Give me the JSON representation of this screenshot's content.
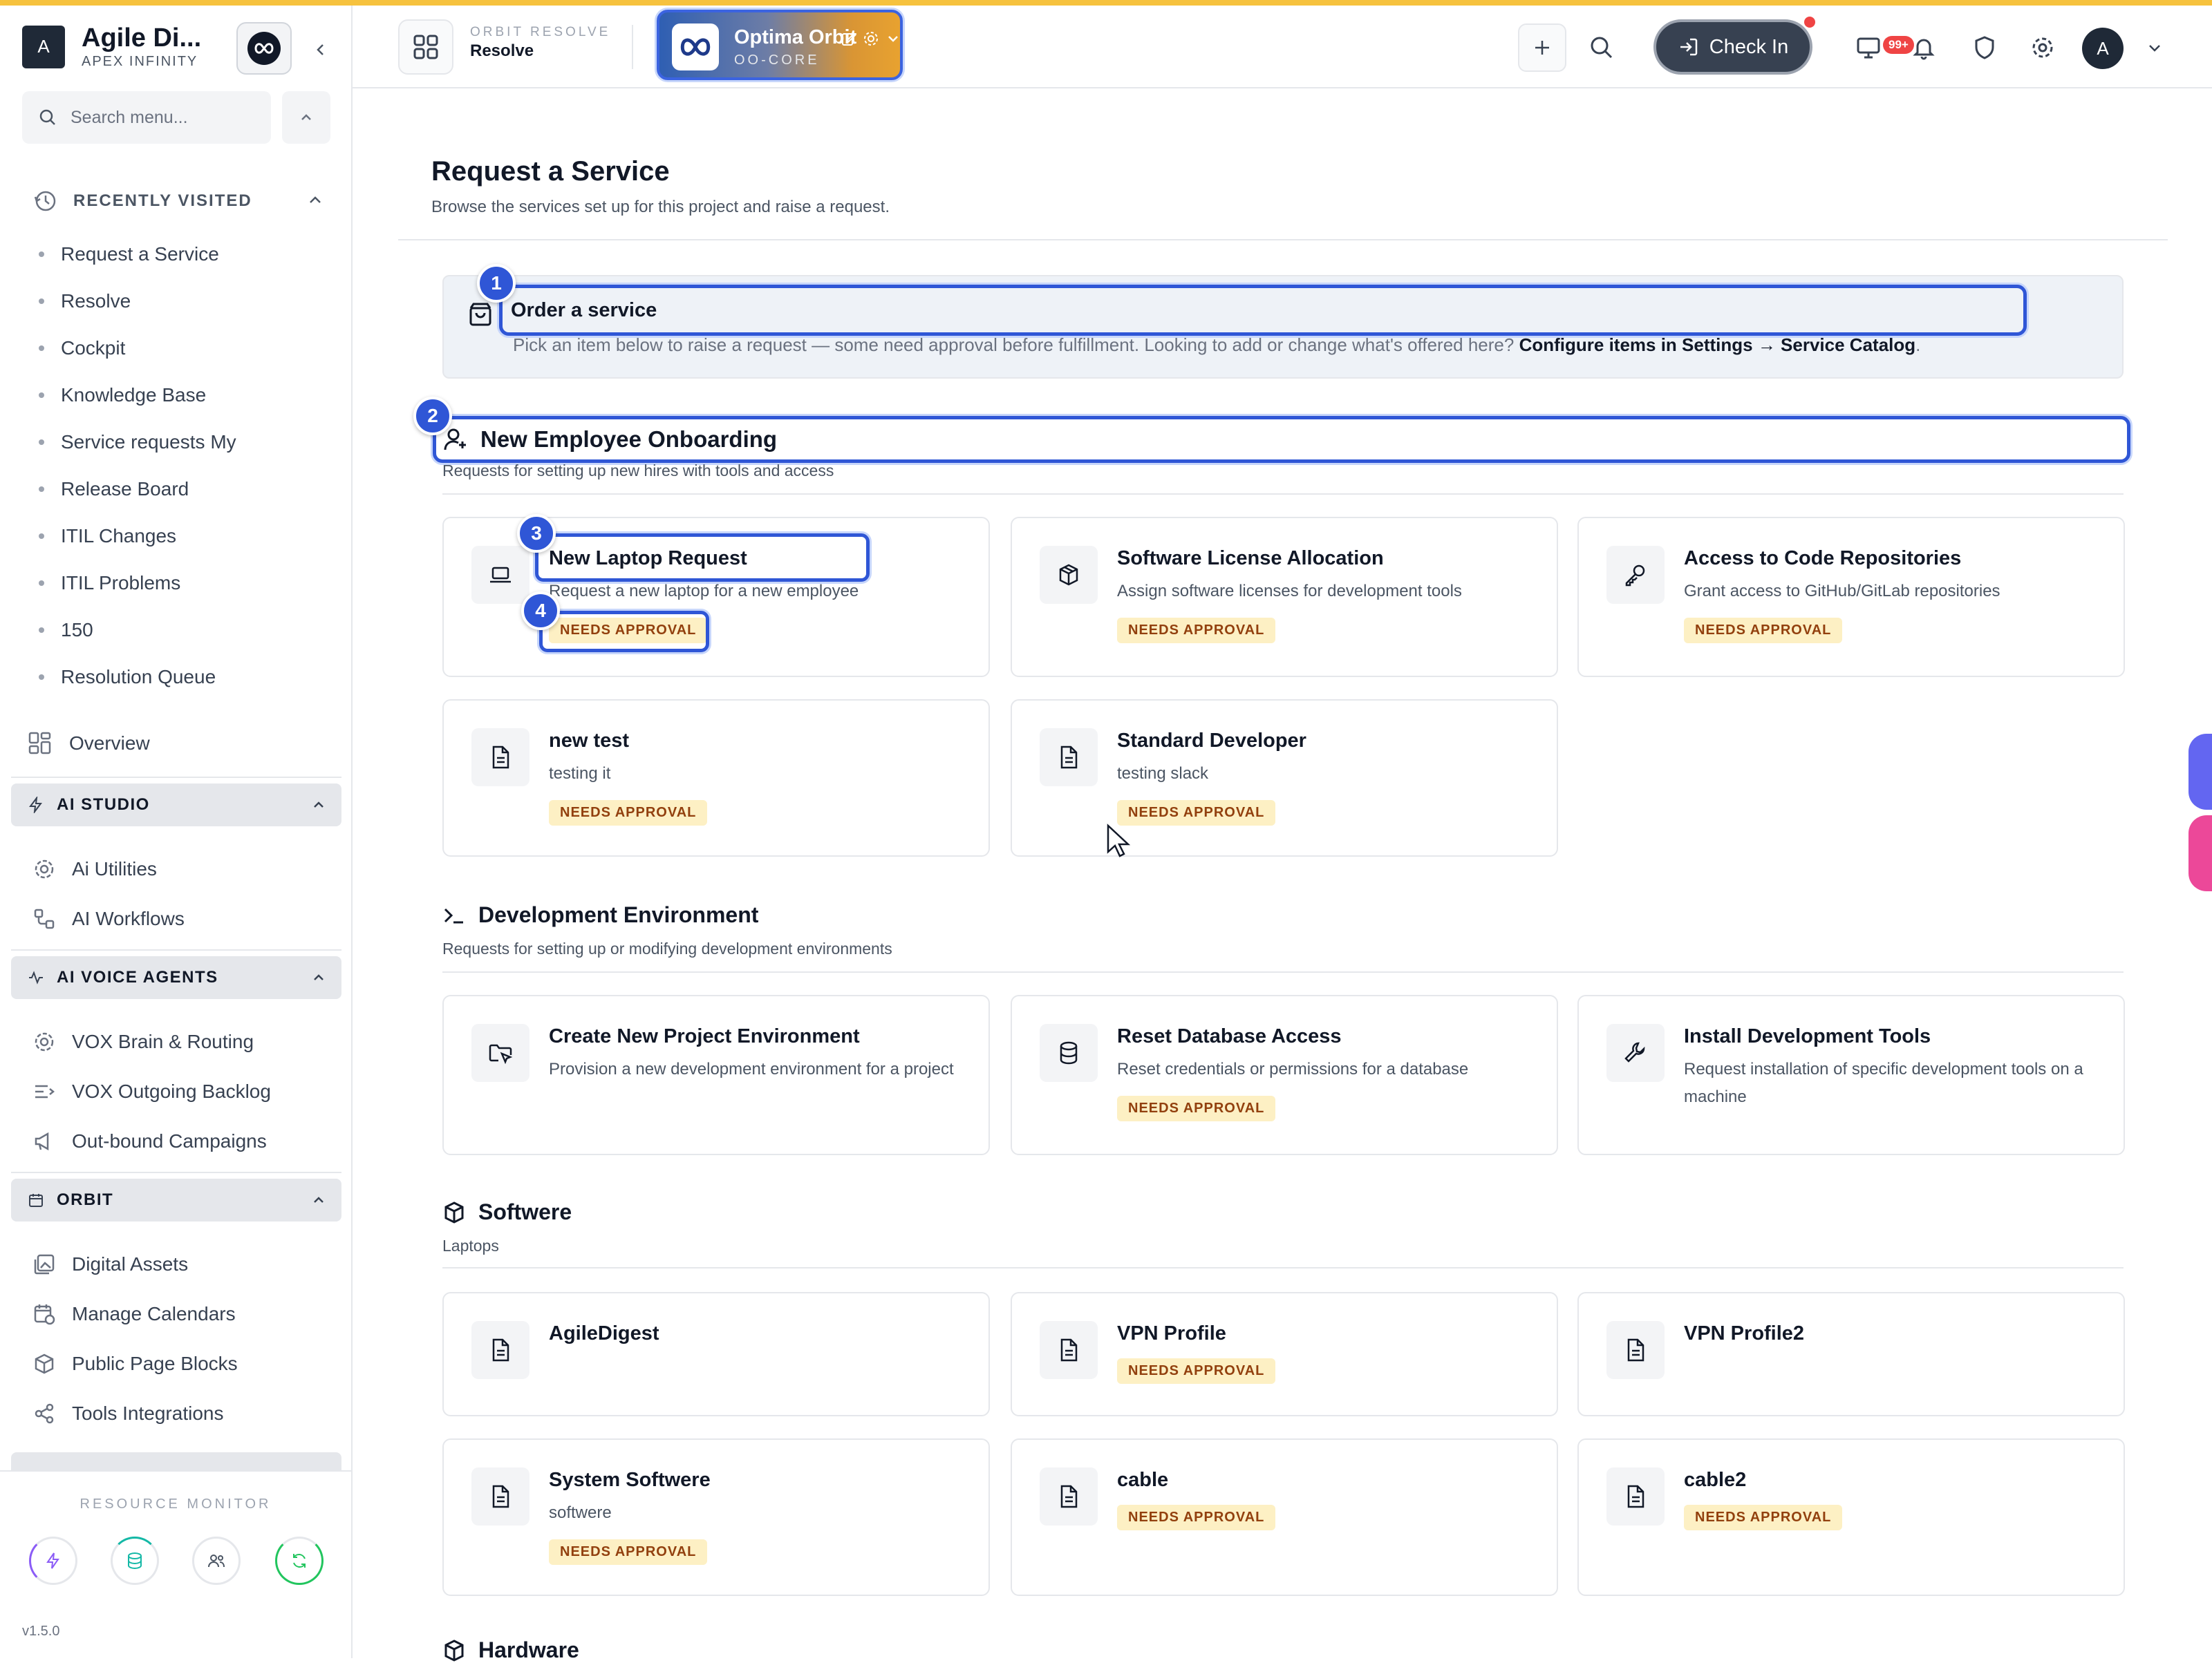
{
  "sidebar": {
    "brand_initial": "A",
    "brand_name": "Agile Di...",
    "brand_sub": "APEX INFINITY",
    "search_placeholder": "Search menu...",
    "recently_visited_label": "RECENTLY VISITED",
    "recent": [
      "Request a Service",
      "Resolve",
      "Cockpit",
      "Knowledge Base",
      "Service requests My",
      "Release Board",
      "ITIL Changes",
      "ITIL Problems",
      "150",
      "Resolution Queue"
    ],
    "overview_label": "Overview",
    "sections": [
      {
        "title": "AI STUDIO",
        "items": [
          "Ai Utilities",
          "AI Workflows"
        ]
      },
      {
        "title": "AI VOICE AGENTS",
        "items": [
          "VOX Brain & Routing",
          "VOX Outgoing Backlog",
          "Out-bound Campaigns"
        ]
      },
      {
        "title": "ORBIT",
        "items": [
          "Digital Assets",
          "Manage Calendars",
          "Public Page Blocks",
          "Tools Integrations"
        ]
      }
    ],
    "resource_monitor_label": "RESOURCE MONITOR",
    "version": "v1.5.0"
  },
  "header": {
    "orbit_label": "ORBIT RESOLVE",
    "orbit_value": "Resolve",
    "project_name": "Optima Orbit",
    "project_code": "OO-CORE",
    "checkin_label": "Check In",
    "notif_count": "99+",
    "avatar_initial": "A"
  },
  "page": {
    "title": "Request a Service",
    "subtitle": "Browse the services set up for this project and raise a request."
  },
  "banner": {
    "title": "Order a service",
    "desc": "Pick an item below to raise a request — some need approval before fulfillment. Looking to add or change what's offered here?",
    "link": "Configure items in Settings → Service Catalog",
    "end": "."
  },
  "markers": [
    "1",
    "2",
    "3",
    "4"
  ],
  "badge_label": "NEEDS APPROVAL",
  "categories": [
    {
      "title": "New Employee Onboarding",
      "desc": "Requests for setting up new hires with tools and access",
      "items": [
        {
          "title": "New Laptop Request",
          "desc": "Request a new laptop for a new employee",
          "badge": true
        },
        {
          "title": "Software License Allocation",
          "desc": "Assign software licenses for development tools",
          "badge": true
        },
        {
          "title": "Access to Code Repositories",
          "desc": "Grant access to GitHub/GitLab repositories",
          "badge": true
        },
        {
          "title": "new test",
          "desc": "testing it",
          "badge": true
        },
        {
          "title": "Standard Developer",
          "desc": "testing slack",
          "badge": true
        }
      ]
    },
    {
      "title": "Development Environment",
      "desc": "Requests for setting up or modifying development environments",
      "items": [
        {
          "title": "Create New Project Environment",
          "desc": "Provision a new development environment for a project",
          "badge": false
        },
        {
          "title": "Reset Database Access",
          "desc": "Reset credentials or permissions for a database",
          "badge": true
        },
        {
          "title": "Install Development Tools",
          "desc": "Request installation of specific development tools on a machine",
          "badge": false
        }
      ]
    },
    {
      "title": "Softwere",
      "desc": "Laptops",
      "items": [
        {
          "title": "AgileDigest",
          "desc": "",
          "badge": false
        },
        {
          "title": "VPN Profile",
          "desc": "",
          "badge": true
        },
        {
          "title": "VPN Profile2",
          "desc": "",
          "badge": false
        },
        {
          "title": "System Softwere",
          "desc": "softwere",
          "badge": true
        },
        {
          "title": "cable",
          "desc": "",
          "badge": true
        },
        {
          "title": "cable2",
          "desc": "",
          "badge": true
        }
      ]
    },
    {
      "title": "Hardware",
      "desc": "",
      "items": []
    }
  ],
  "colors": {
    "accent": "#2f56d6",
    "badge_bg": "#fdf0c4",
    "badge_fg": "#92400e",
    "top_stripe": "#f6c23e"
  }
}
